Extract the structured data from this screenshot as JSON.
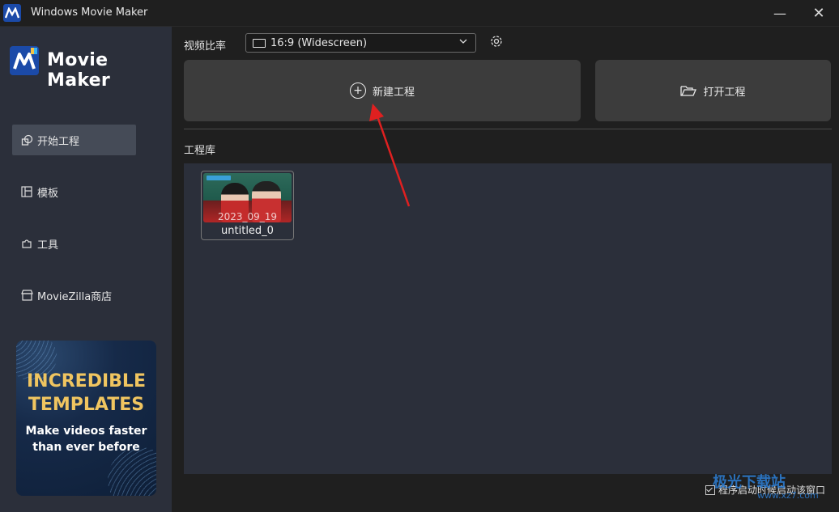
{
  "window": {
    "title": "Windows Movie Maker",
    "minimize_glyph": "—",
    "close_glyph": "✕"
  },
  "sidebar": {
    "brand": "Movie Maker",
    "items": [
      {
        "label": "开始工程",
        "icon": "shapes-icon",
        "active": true
      },
      {
        "label": "模板",
        "icon": "template-icon",
        "active": false
      },
      {
        "label": "工具",
        "icon": "puzzle-icon",
        "active": false
      },
      {
        "label": "MovieZilla商店",
        "icon": "store-icon",
        "active": false
      }
    ],
    "promo": {
      "title_line1": "INCREDIBLE",
      "title_line2": "TEMPLATES",
      "sub_line1": "Make videos faster",
      "sub_line2": "than ever before"
    }
  },
  "toolbar": {
    "ratio_label": "视频比率",
    "ratio_value": "16:9 (Widescreen)"
  },
  "actions": {
    "new_project": "新建工程",
    "open_project": "打开工程"
  },
  "library": {
    "label": "工程库",
    "projects": [
      {
        "name": "untitled_0",
        "date": "2023_09_19"
      }
    ]
  },
  "footer": {
    "startup_checkbox_label": "程序启动时候启动该窗口",
    "startup_checked": true
  },
  "watermark": {
    "text": "极光下载站",
    "sub": "www.xz7.com"
  },
  "colors": {
    "accent_blue": "#1b4aa8",
    "promo_gold": "#f0c560",
    "annotation_arrow": "#e02020"
  }
}
